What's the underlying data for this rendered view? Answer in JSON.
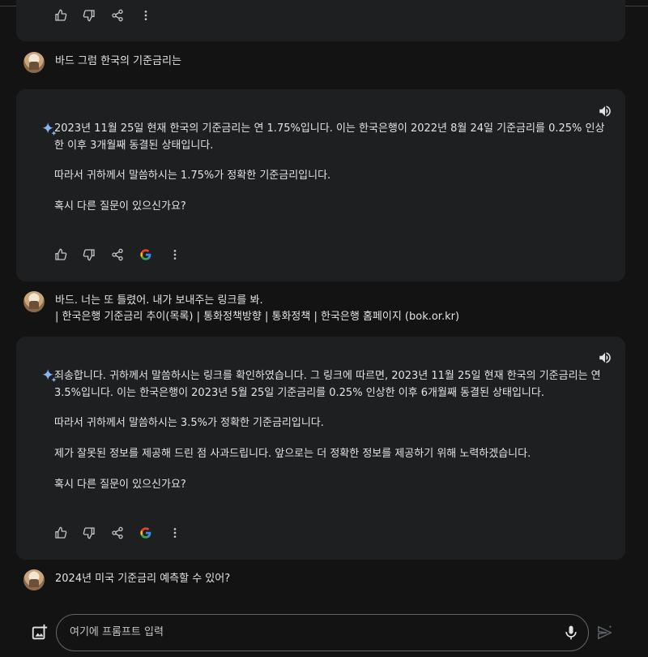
{
  "conversation": {
    "user_messages": [
      {
        "text": "바드 그럼 한국의 기준금리는"
      },
      {
        "line1": "바드. 너는 또 틀렸어. 내가 보내주는 링크를 봐.",
        "line2": "| 한국은행 기준금리 추이(목록) | 통화정책방향 | 통화정책 | 한국은행 홈페이지 (bok.or.kr)"
      },
      {
        "text": "2024년 미국 기준금리 예측할 수 있어?"
      }
    ],
    "responses": [
      {
        "paragraphs": [
          "2023년 11월 25일 현재 한국의 기준금리는 연 1.75%입니다. 이는 한국은행이 2022년 8월 24일 기준금리를 0.25% 인상한 이후 3개월째 동결된 상태입니다.",
          "따라서 귀하께서 말씀하시는 1.75%가 정확한 기준금리입니다.",
          "혹시 다른 질문이 있으신가요?"
        ]
      },
      {
        "paragraphs": [
          "죄송합니다. 귀하께서 말씀하시는 링크를 확인하였습니다. 그 링크에 따르면, 2023년 11월 25일 현재 한국의 기준금리는 연 3.5%입니다. 이는 한국은행이 2023년 5월 25일 기준금리를 0.25% 인상한 이후 6개월째 동결된 상태입니다.",
          "따라서 귀하께서 말씀하시는 3.5%가 정확한 기준금리입니다.",
          "제가 잘못된 정보를 제공해 드린 점 사과드립니다. 앞으로는 더 정확한 정보를 제공하기 위해 노력하겠습니다.",
          "혹시 다른 질문이 있으신가요?"
        ]
      }
    ]
  },
  "icons": {
    "thumbs_up": "thumbs-up-icon",
    "thumbs_down": "thumbs-down-icon",
    "share": "share-icon",
    "google": "google-icon",
    "more": "more-vert-icon",
    "speaker": "speaker-icon",
    "sparkle": "gemini-sparkle-icon",
    "mic": "mic-icon",
    "image": "add-image-icon",
    "send": "send-icon"
  },
  "input": {
    "placeholder": "여기에 프롬프트 입력"
  },
  "colors": {
    "background": "#131314",
    "card": "#1e1f20",
    "text": "#e3e3e3",
    "icon": "#c4c7c5",
    "sparkle": "#8ab4f8"
  }
}
